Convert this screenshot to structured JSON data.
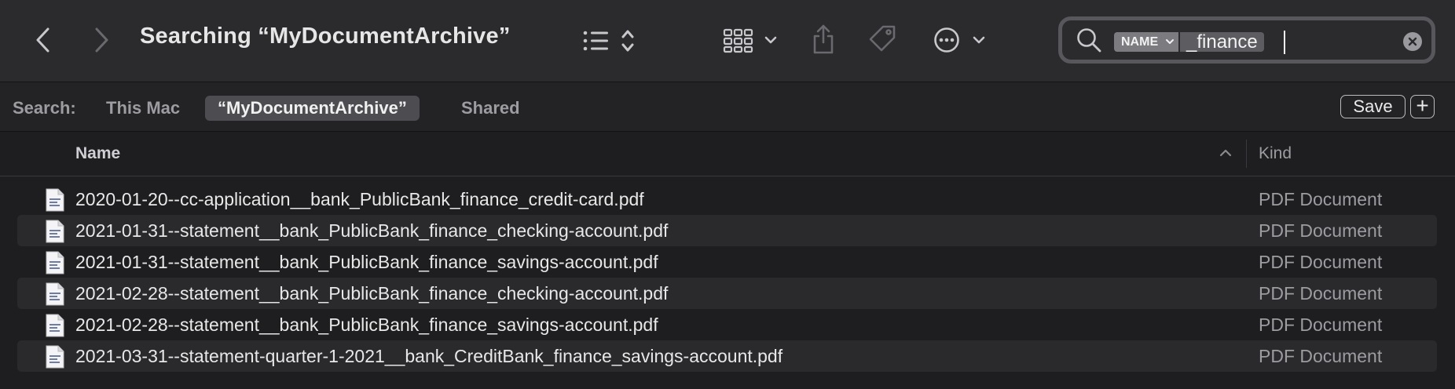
{
  "window": {
    "title": "Searching “MyDocumentArchive”"
  },
  "toolbar": {
    "icons": [
      "chevron-left-icon",
      "chevron-right-icon",
      "list-view-icon",
      "sort-updown-icon",
      "grid-view-icon",
      "share-icon",
      "tag-icon",
      "more-actions-icon"
    ]
  },
  "search": {
    "token_name": "NAME",
    "token_value": "_finance",
    "icon": "search-icon"
  },
  "scopebar": {
    "label": "Search:",
    "scopes": [
      {
        "label": "This Mac",
        "selected": false
      },
      {
        "label": "“MyDocumentArchive”",
        "selected": true
      },
      {
        "label": "Shared",
        "selected": false
      }
    ],
    "save_label": "Save",
    "add_label": "+"
  },
  "columns": {
    "name": "Name",
    "kind": "Kind"
  },
  "files": [
    {
      "name": "2020-01-20--cc-application__bank_PublicBank_finance_credit-card.pdf",
      "kind": "PDF Document"
    },
    {
      "name": "2021-01-31--statement__bank_PublicBank_finance_checking-account.pdf",
      "kind": "PDF Document"
    },
    {
      "name": "2021-01-31--statement__bank_PublicBank_finance_savings-account.pdf",
      "kind": "PDF Document"
    },
    {
      "name": "2021-02-28--statement__bank_PublicBank_finance_checking-account.pdf",
      "kind": "PDF Document"
    },
    {
      "name": "2021-02-28--statement__bank_PublicBank_finance_savings-account.pdf",
      "kind": "PDF Document"
    },
    {
      "name": "2021-03-31--statement-quarter-1-2021__bank_CreditBank_finance_savings-account.pdf",
      "kind": "PDF Document"
    }
  ],
  "colors": {
    "toolbar_bg": "#2b2a2d",
    "window_bg": "#1e1e20",
    "row_alt": "#2a292c",
    "text_primary": "#e8e8e8",
    "text_secondary": "#9d9ca1"
  }
}
